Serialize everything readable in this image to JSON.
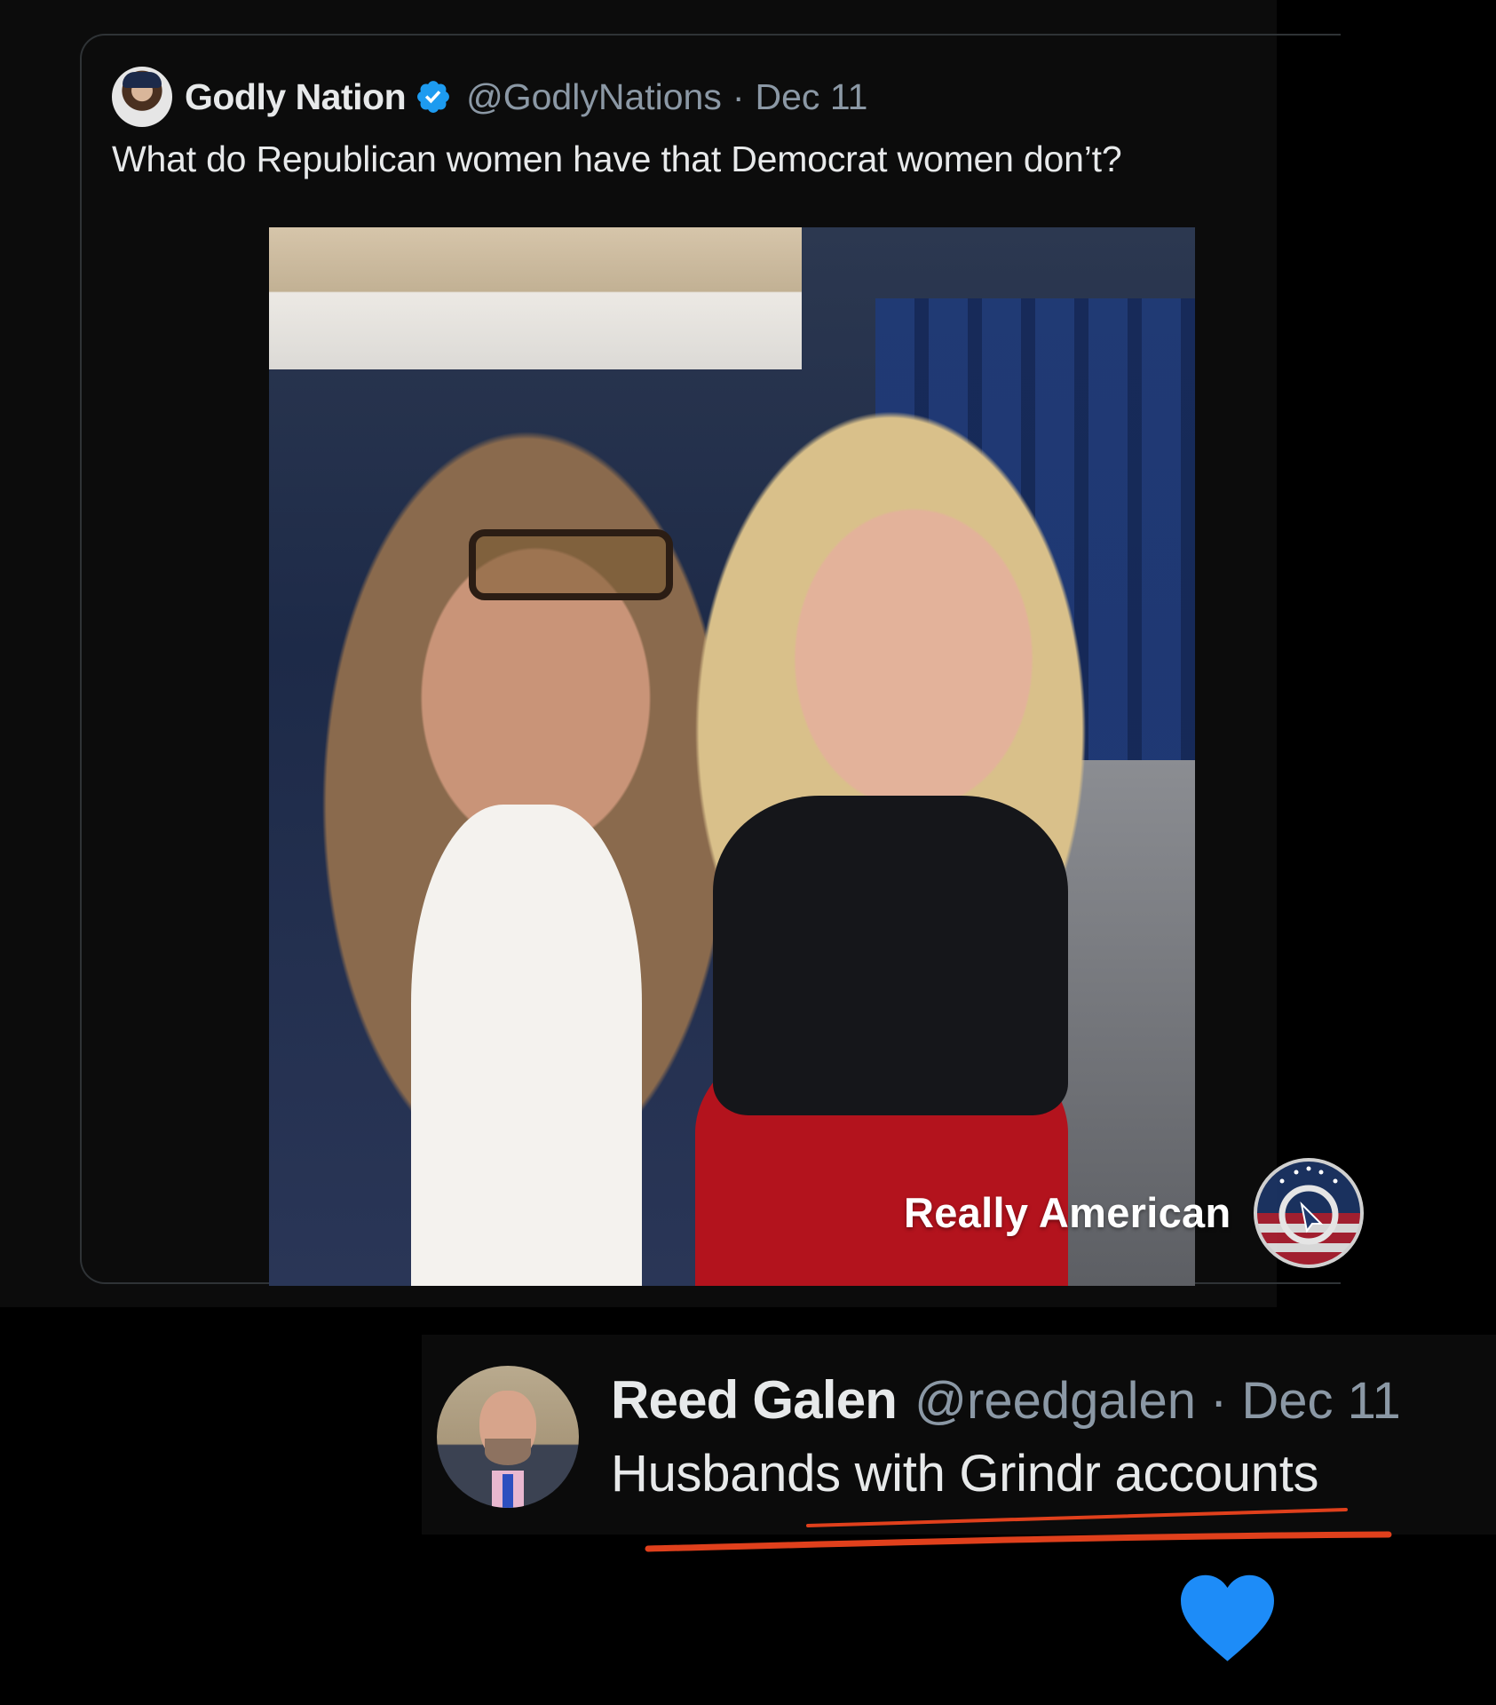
{
  "original_post": {
    "display_name": "Godly Nation",
    "handle": "@GodlyNations",
    "separator": "·",
    "date": "Dec 11",
    "text": "What do Republican women have that Democrat women don’t?",
    "avatar_icon": "profile-avatar",
    "verified_icon": "verified-badge-icon"
  },
  "watermark": {
    "text": "Really American",
    "logo_icon": "really-american-logo-icon"
  },
  "reply": {
    "display_name": "Reed Galen",
    "handle": "@reedgalen",
    "separator": "·",
    "date": "Dec 11",
    "text": "Husbands with Grindr accounts",
    "avatar_icon": "profile-avatar"
  },
  "decorations": {
    "underline_color": "#e0401c",
    "heart_icon": "heart-icon",
    "heart_color": "#1d8cf8"
  },
  "colors": {
    "background": "#000000",
    "panel": "#0c0c0c",
    "text_primary": "#e7e9ea",
    "text_secondary": "#8b98a5",
    "verified_blue": "#1d9bf0"
  }
}
